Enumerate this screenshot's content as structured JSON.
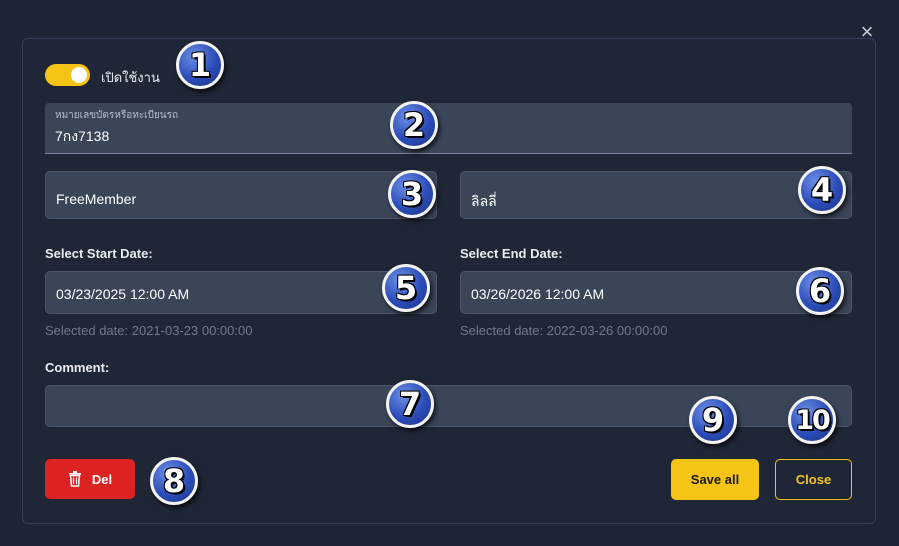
{
  "modal": {
    "close_icon": "×",
    "toggle": {
      "label": "เปิดใช้งาน",
      "on": true
    },
    "plate_field": {
      "label": "หมายเลขบัตรหรือทะเบียนรถ",
      "value": "7กง7138"
    },
    "member_field": {
      "value": "FreeMember"
    },
    "name_field": {
      "value": "ลิลลี่"
    },
    "start_date": {
      "label": "Select Start Date:",
      "value": "03/23/2025  12:00  AM",
      "helper": "Selected date: 2021-03-23 00:00:00"
    },
    "end_date": {
      "label": "Select End Date:",
      "value": "03/26/2026  12:00  AM",
      "helper": "Selected date: 2022-03-26 00:00:00"
    },
    "comment": {
      "label": "Comment:",
      "value": ""
    },
    "buttons": {
      "delete": "Del",
      "save": "Save all",
      "close": "Close"
    },
    "badges": [
      "1",
      "2",
      "3",
      "4",
      "5",
      "6",
      "7",
      "8",
      "9",
      "10"
    ],
    "colors": {
      "accent": "#f6c417",
      "danger": "#dd2222",
      "badge": "#2b4cb8"
    }
  }
}
